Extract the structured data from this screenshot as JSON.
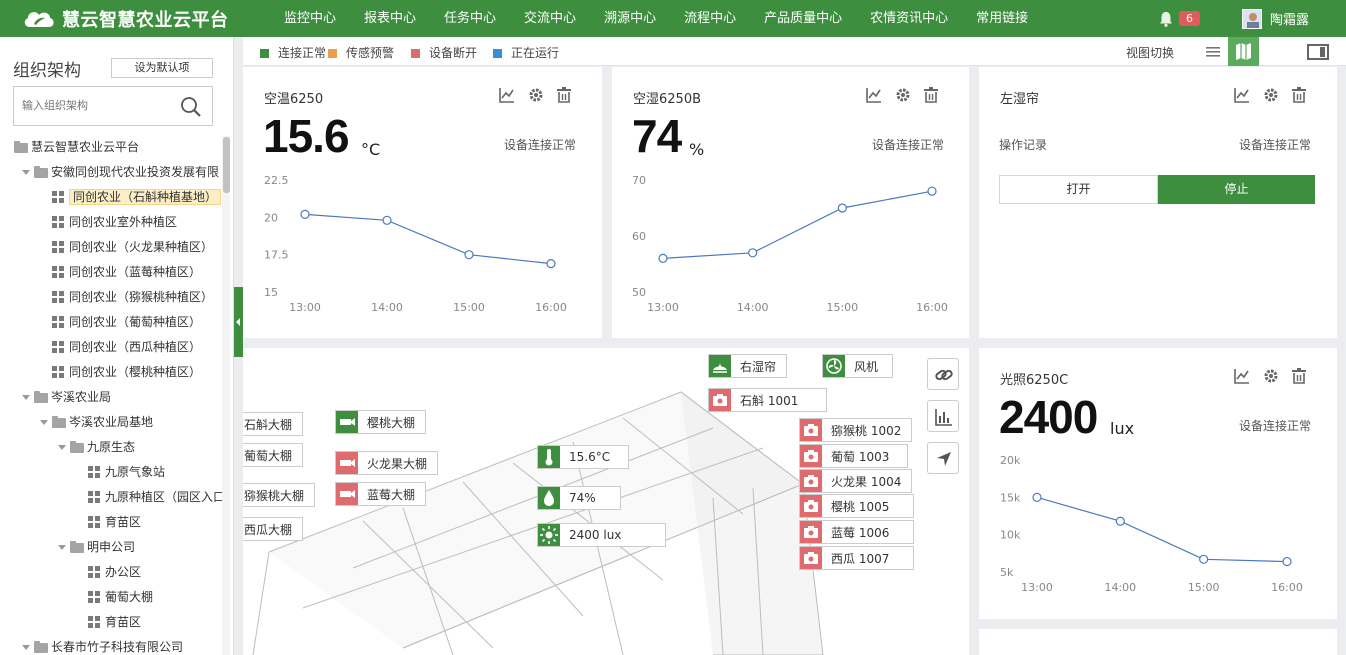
{
  "app": {
    "title": "慧云智慧农业云平台"
  },
  "nav": [
    {
      "label": "监控中心"
    },
    {
      "label": "报表中心"
    },
    {
      "label": "任务中心"
    },
    {
      "label": "交流中心"
    },
    {
      "label": "溯源中心"
    },
    {
      "label": "流程中心"
    },
    {
      "label": "产品质量中心"
    },
    {
      "label": "农情资讯中心"
    },
    {
      "label": "常用链接"
    }
  ],
  "user": {
    "notifications": "6",
    "name": "陶霜露"
  },
  "sidebar": {
    "title": "组织架构",
    "set_default": "设为默认项",
    "search_placeholder": "输入组织架构",
    "tree": [
      {
        "label": "慧云智慧农业云平台",
        "type": "folder",
        "depth": 0
      },
      {
        "label": "安徽同创现代农业投资发展有限",
        "type": "folder",
        "depth": 1,
        "expanded": true
      },
      {
        "label": "同创农业（石斛种植基地）",
        "type": "grid",
        "depth": 2,
        "selected": true
      },
      {
        "label": "同创农业室外种植区",
        "type": "grid",
        "depth": 2
      },
      {
        "label": "同创农业（火龙果种植区）",
        "type": "grid",
        "depth": 2
      },
      {
        "label": "同创农业（蓝莓种植区）",
        "type": "grid",
        "depth": 2
      },
      {
        "label": "同创农业（猕猴桃种植区）",
        "type": "grid",
        "depth": 2
      },
      {
        "label": "同创农业（葡萄种植区）",
        "type": "grid",
        "depth": 2
      },
      {
        "label": "同创农业（西瓜种植区）",
        "type": "grid",
        "depth": 2
      },
      {
        "label": "同创农业（樱桃种植区）",
        "type": "grid",
        "depth": 2
      },
      {
        "label": "岑溪农业局",
        "type": "folder",
        "depth": 1,
        "expanded": true
      },
      {
        "label": "岑溪农业局基地",
        "type": "folder",
        "depth": 2,
        "expanded": true
      },
      {
        "label": "九原生态",
        "type": "folder",
        "depth": 3,
        "expanded": true
      },
      {
        "label": "九原气象站",
        "type": "grid",
        "depth": 4
      },
      {
        "label": "九原种植区（园区入口",
        "type": "grid",
        "depth": 4
      },
      {
        "label": "育苗区",
        "type": "grid",
        "depth": 4
      },
      {
        "label": "明申公司",
        "type": "folder",
        "depth": 3,
        "expanded": true
      },
      {
        "label": "办公区",
        "type": "grid",
        "depth": 4
      },
      {
        "label": "葡萄大棚",
        "type": "grid",
        "depth": 4
      },
      {
        "label": "育苗区",
        "type": "grid",
        "depth": 4
      },
      {
        "label": "长春市竹子科技有限公司",
        "type": "folder",
        "depth": 1,
        "expanded": true
      }
    ]
  },
  "legend": [
    {
      "label": "连接正常",
      "color": "#3d8f3f"
    },
    {
      "label": "传感预警",
      "color": "#e8a04f"
    },
    {
      "label": "设备断开",
      "color": "#e06b6e"
    },
    {
      "label": "正在运行",
      "color": "#3a8ed6"
    }
  ],
  "view_switch": "视图切换",
  "cards": {
    "temp": {
      "title": "空温6250",
      "value": "15.6",
      "unit": "°C",
      "status": "设备连接正常",
      "chart_data": {
        "type": "line",
        "x": [
          "13:00",
          "14:00",
          "15:00",
          "16:00"
        ],
        "y_ticks": [
          "22.5",
          "20",
          "17.5",
          "15"
        ],
        "ylim": [
          15,
          22.5
        ],
        "values": [
          20.2,
          19.8,
          17.5,
          16.9
        ]
      }
    },
    "humidity": {
      "title": "空湿6250B",
      "value": "74",
      "unit": "%",
      "status": "设备连接正常",
      "chart_data": {
        "type": "line",
        "x": [
          "13:00",
          "14:00",
          "15:00",
          "16:00"
        ],
        "y_ticks": [
          "70",
          "60",
          "50"
        ],
        "ylim": [
          50,
          70
        ],
        "values": [
          56,
          57,
          65,
          68
        ]
      }
    },
    "curtain": {
      "title": "左湿帘",
      "op_label": "操作记录",
      "status": "设备连接正常",
      "open_label": "打开",
      "stop_label": "停止"
    },
    "light": {
      "title": "光照6250C",
      "value": "2400",
      "unit": "lux",
      "status": "设备连接正常",
      "chart_data": {
        "type": "line",
        "x": [
          "13:00",
          "14:00",
          "15:00",
          "16:00"
        ],
        "y_ticks": [
          "20k",
          "15k",
          "10k",
          "5k"
        ],
        "ylim": [
          5000,
          20000
        ],
        "values": [
          15000,
          11800,
          6700,
          6400
        ]
      }
    }
  },
  "scene": {
    "left_tags": [
      {
        "label": "石斛大棚"
      },
      {
        "label": "葡萄大棚"
      },
      {
        "label": "猕猴桃大棚"
      },
      {
        "label": "西瓜大棚"
      }
    ],
    "mid_tags": [
      {
        "label": "樱桃大棚",
        "kind": "camera-green"
      },
      {
        "label": "火龙果大棚",
        "kind": "camera-red"
      },
      {
        "label": "蓝莓大棚",
        "kind": "camera-red"
      }
    ],
    "sensor_tags": [
      {
        "label": "15.6°C",
        "icon": "thermometer-icon"
      },
      {
        "label": "74%",
        "icon": "water-drop-icon"
      },
      {
        "label": "2400 lux",
        "icon": "sun-icon"
      }
    ],
    "top_tags": [
      {
        "label": "右湿帘",
        "icon": "curtain-icon"
      },
      {
        "label": "风机",
        "icon": "fan-icon"
      },
      {
        "label": "石斛 1001",
        "icon": "camera-icon"
      }
    ],
    "right_tags": [
      {
        "label": "猕猴桃 1002"
      },
      {
        "label": "葡萄 1003"
      },
      {
        "label": "火龙果 1004"
      },
      {
        "label": "樱桃 1005"
      },
      {
        "label": "蓝莓 1006"
      },
      {
        "label": "西瓜 1007"
      }
    ]
  }
}
